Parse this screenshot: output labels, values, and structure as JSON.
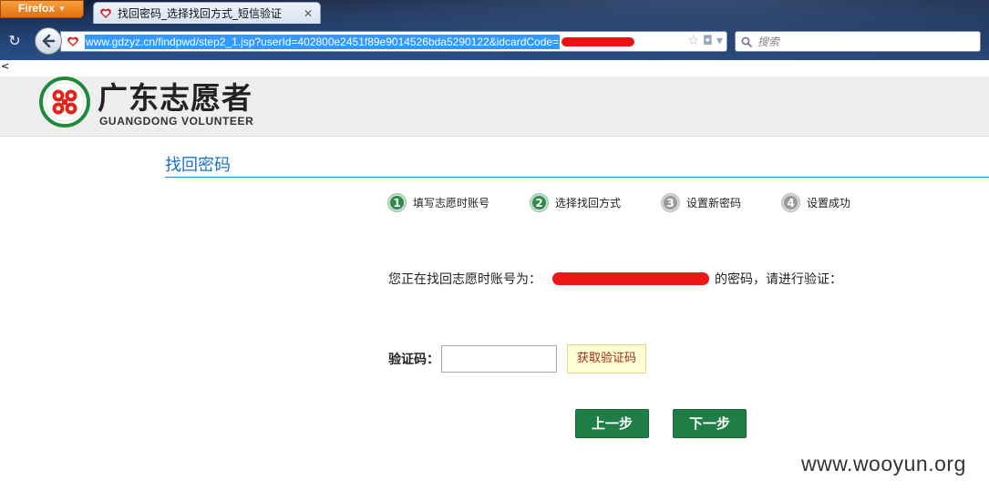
{
  "browser": {
    "menu_button_label": "Firefox",
    "tab_title": "找回密码_选择找回方式_短信验证",
    "url_text": "www.gdzyz.cn/findpwd/step2_1.jsp?userId=402800e2451f89e9014526bda5290122&idcardCode=",
    "search_placeholder": "搜索"
  },
  "page": {
    "stray_char": "<",
    "logo_cn": "广东志愿者",
    "logo_en": "GUANGDONG VOLUNTEER",
    "title": "找回密码",
    "steps": [
      {
        "num": "1",
        "label": "填写志愿时账号",
        "state": "done"
      },
      {
        "num": "2",
        "label": "选择找回方式",
        "state": "current"
      },
      {
        "num": "3",
        "label": "设置新密码",
        "state": "pending"
      },
      {
        "num": "4",
        "label": "设置成功",
        "state": "pending"
      }
    ],
    "prompt_prefix": "您正在找回志愿时账号为：",
    "prompt_suffix": "的密码，请进行验证：",
    "code_label": "验证码：",
    "code_value": "",
    "get_code_label": "获取验证码",
    "prev_label": "上一步",
    "next_label": "下一步"
  },
  "watermark": "www.wooyun.org",
  "colors": {
    "accent_blue": "#1a72c6",
    "primary_green": "#1e7e45",
    "redaction_red": "#ee1515",
    "firefox_orange": "#e46f0f"
  }
}
